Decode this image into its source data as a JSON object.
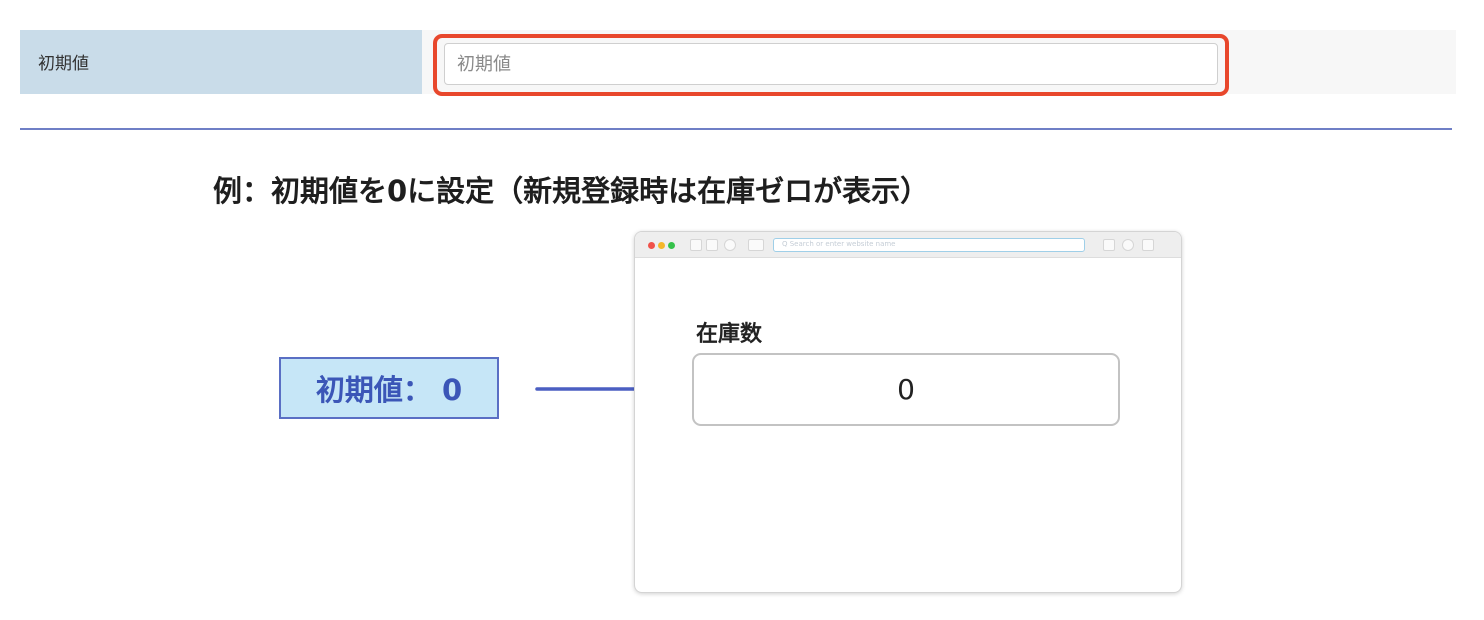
{
  "setting": {
    "label": "初期値",
    "input_placeholder": "初期値",
    "input_value": ""
  },
  "example": {
    "title": "例：初期値を0に設定（新規登録時は在庫ゼロが表示）",
    "callout_text": "初期値： 0"
  },
  "browser": {
    "field_label": "在庫数",
    "field_value": "0",
    "address_text": "Q Search or enter website name"
  },
  "colors": {
    "highlight_border": "#e8472c",
    "label_cell_bg": "#c9dce9",
    "divider": "#6f7fc6",
    "callout_bg": "#c6e6f7",
    "callout_text": "#3b56b7",
    "arrow": "#4b5fc2"
  },
  "icons": {
    "arrow": "arrow-right-icon",
    "window_controls": [
      "close-dot",
      "minimize-dot",
      "zoom-dot"
    ],
    "toolbar": [
      "back-icon",
      "forward-icon",
      "reload-icon",
      "sidebar-icon",
      "share-icon",
      "extension-icon",
      "download-icon"
    ]
  }
}
